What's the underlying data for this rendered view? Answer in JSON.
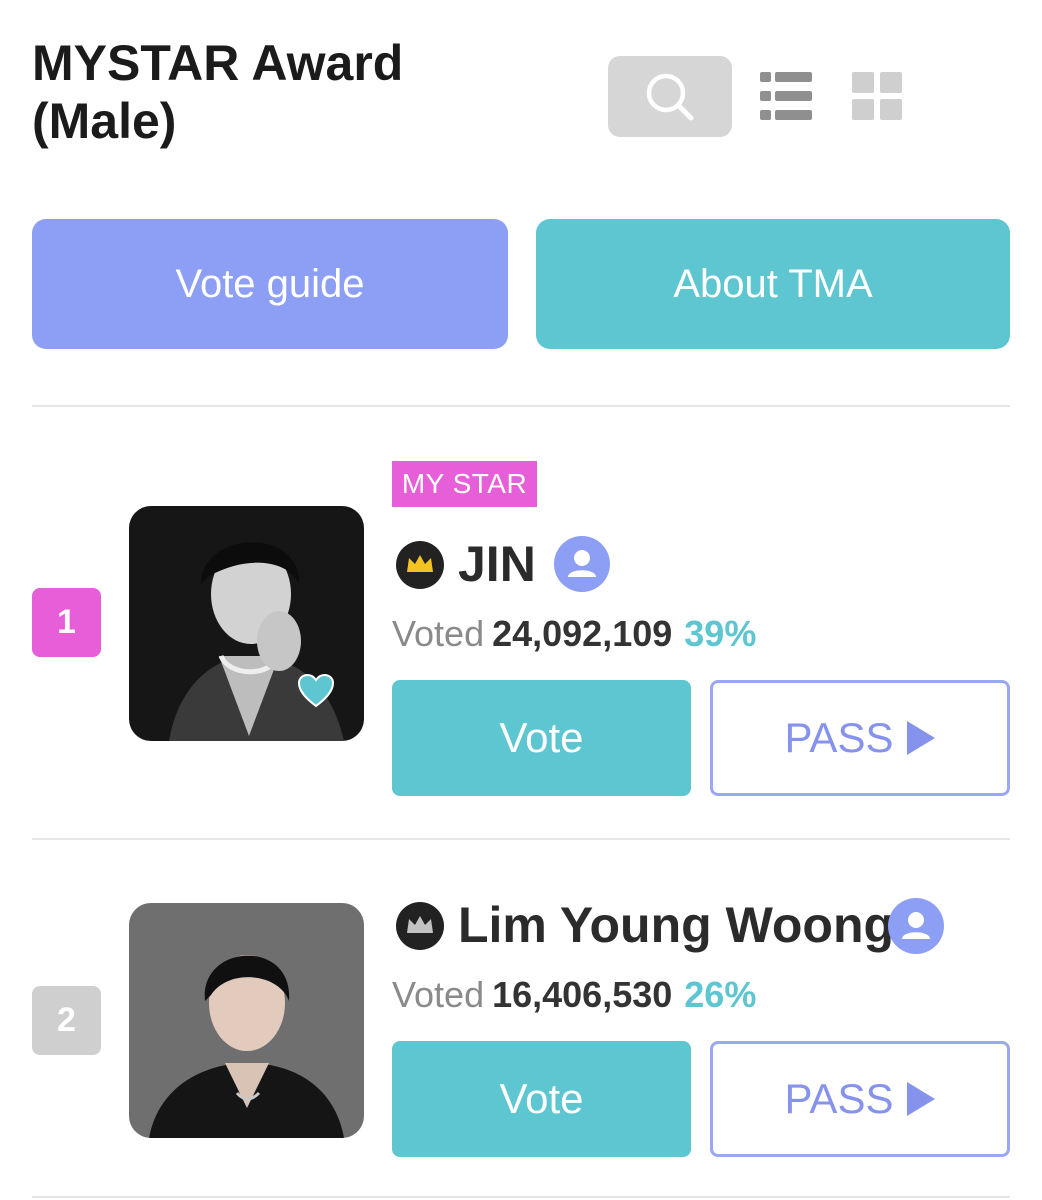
{
  "header": {
    "title": "MYSTAR Award (Male)",
    "search_icon": "search-icon",
    "list_view_icon": "list-view-icon",
    "grid_view_icon": "grid-view-icon"
  },
  "actions": {
    "vote_guide": "Vote guide",
    "about_tma": "About TMA"
  },
  "colors": {
    "vote_guide_bg": "#8d9ef5",
    "accent_teal": "#5ec6d0",
    "mystar_pink": "#e65fd8",
    "rank_1_bg": "#e65fd8",
    "rank_2_bg": "#cfcfcf"
  },
  "candidates": [
    {
      "rank": "1",
      "tag": "MY STAR",
      "name": "JIN",
      "crown_icon": "gold-crown-icon",
      "voted_label": "Voted",
      "votes": "24,092,109",
      "percent": "39%",
      "vote_label": "Vote",
      "pass_label": "PASS"
    },
    {
      "rank": "2",
      "name": "Lim Young Woong",
      "crown_icon": "silver-crown-icon",
      "voted_label": "Voted",
      "votes": "16,406,530",
      "percent": "26%",
      "vote_label": "Vote",
      "pass_label": "PASS"
    }
  ]
}
